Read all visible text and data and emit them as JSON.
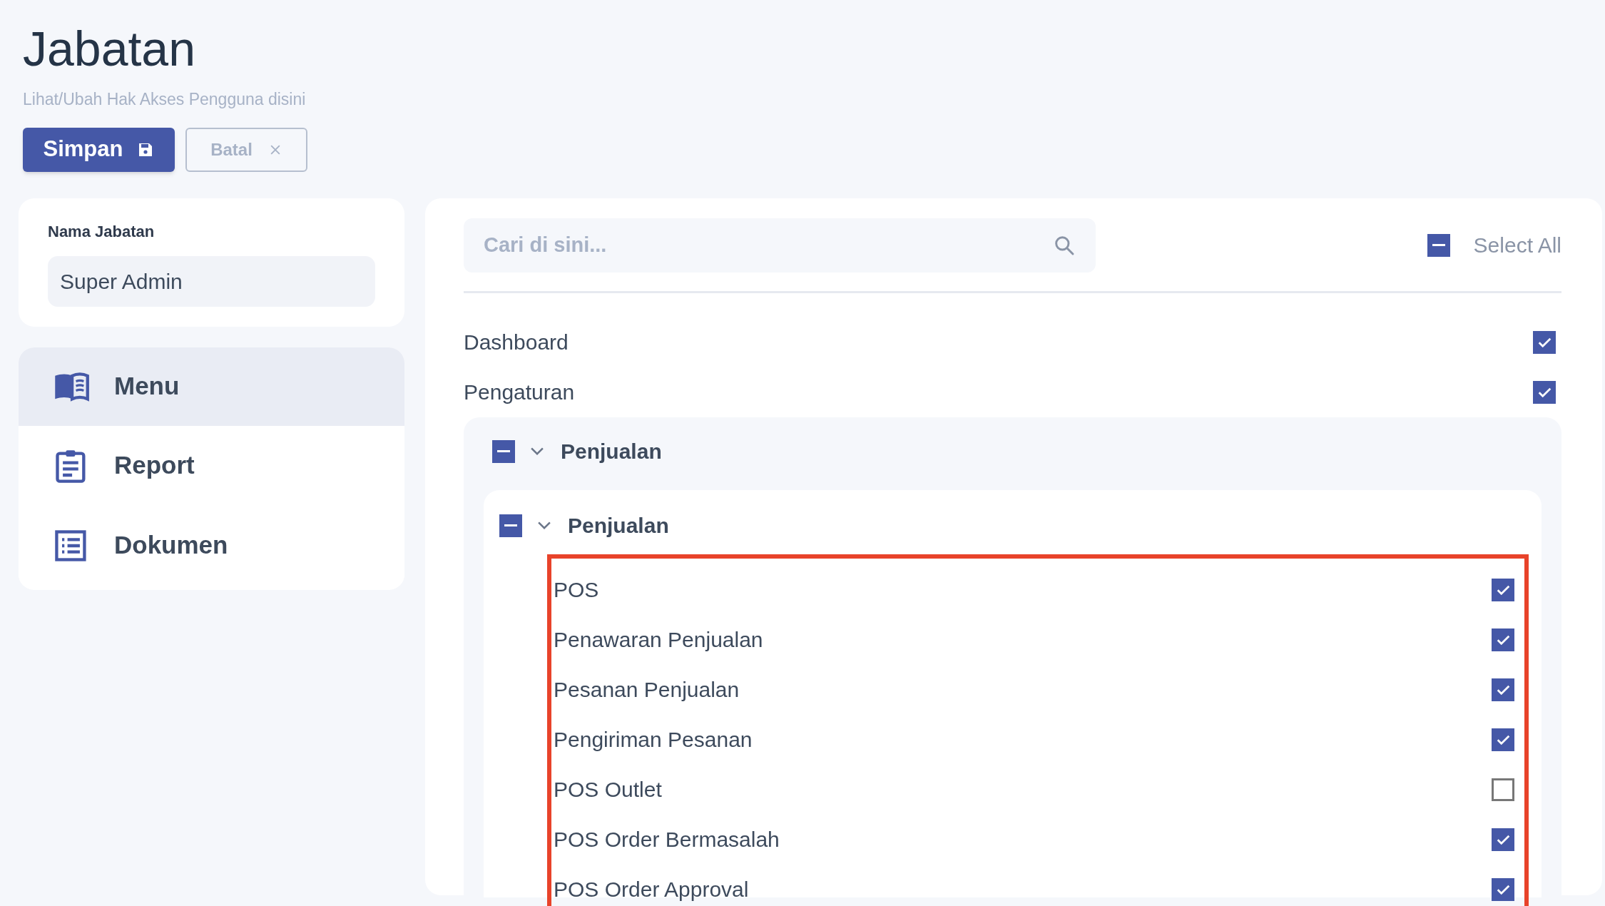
{
  "header": {
    "title": "Jabatan",
    "subtitle": "Lihat/Ubah Hak Akses Pengguna disini"
  },
  "actions": [
    {
      "kind": "primary",
      "label": "Simpan"
    },
    {
      "kind": "secondary",
      "label": "Batal"
    }
  ],
  "role_field": {
    "label": "Nama Jabatan",
    "value": "Super Admin"
  },
  "sidebar": {
    "items": [
      {
        "kind": "book",
        "label": "Menu",
        "selected": true
      },
      {
        "kind": "clipboard",
        "label": "Report",
        "selected": false
      },
      {
        "kind": "list",
        "label": "Dokumen",
        "selected": false
      }
    ]
  },
  "permissions": {
    "search": {
      "placeholder": "Cari di sini..."
    },
    "select_all": {
      "label": "Select All",
      "partial": true
    },
    "items": [
      {
        "label": "Dashboard",
        "checked": true
      },
      {
        "label": "Pengaturan",
        "checked": true
      }
    ],
    "groups": [
      {
        "label": "Penjualan",
        "partial": true,
        "expanded": true,
        "children": [
          {
            "label": "Penjualan",
            "partial": true,
            "expanded": true,
            "children": [
              {
                "label": "POS",
                "checked": true
              },
              {
                "label": "Penawaran Penjualan",
                "checked": true
              },
              {
                "label": "Pesanan Penjualan",
                "checked": true
              },
              {
                "label": "Pengiriman Pesanan",
                "checked": true
              },
              {
                "label": "POS Outlet",
                "checked": false
              },
              {
                "label": "POS Order Bermasalah",
                "checked": true
              },
              {
                "label": "POS Order Approval",
                "checked": true
              }
            ]
          }
        ]
      }
    ]
  }
}
